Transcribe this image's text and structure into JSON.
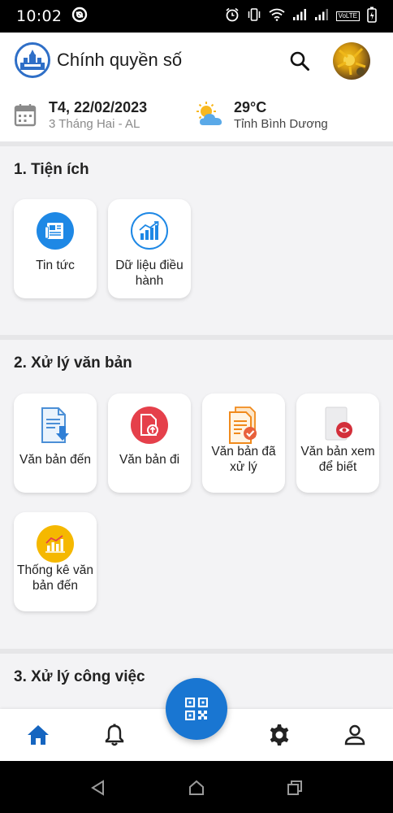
{
  "status_bar": {
    "time": "10:02",
    "network_label": "VoLTE"
  },
  "header": {
    "title": "Chính quyền số",
    "logo_icon": "city-logo-icon",
    "search_icon": "search-icon",
    "avatar_icon": "user-avatar"
  },
  "info": {
    "date": "T4, 22/02/2023",
    "lunar_date": "3 Tháng Hai - AL",
    "temperature": "29°C",
    "location": "Tỉnh Bình Dương"
  },
  "sections": {
    "utilities": {
      "title": "1. Tiện ích",
      "items": [
        {
          "label": "Tin tức",
          "icon": "news-icon"
        },
        {
          "label": "Dữ liệu điều hành",
          "icon": "chart-icon"
        }
      ]
    },
    "documents": {
      "title": "2. Xử lý văn bản",
      "items": [
        {
          "label": "Văn bản đến",
          "icon": "incoming-document-icon"
        },
        {
          "label": "Văn bản đi",
          "icon": "outgoing-document-icon"
        },
        {
          "label": "Văn bản đã xử lý",
          "icon": "processed-document-icon"
        },
        {
          "label": "Văn bản xem để biết",
          "icon": "view-document-icon"
        },
        {
          "label": "Thống kê văn bản đến",
          "icon": "statistics-icon"
        }
      ]
    },
    "work": {
      "title": "3. Xử lý công việc"
    }
  },
  "bottom_nav": {
    "items": [
      "home-icon",
      "bell-icon",
      "qr-code-icon",
      "gear-icon",
      "user-icon"
    ],
    "active": "home-icon"
  },
  "colors": {
    "primary": "#1976d2",
    "accent_red": "#e5404b",
    "accent_yellow": "#f5b800"
  }
}
